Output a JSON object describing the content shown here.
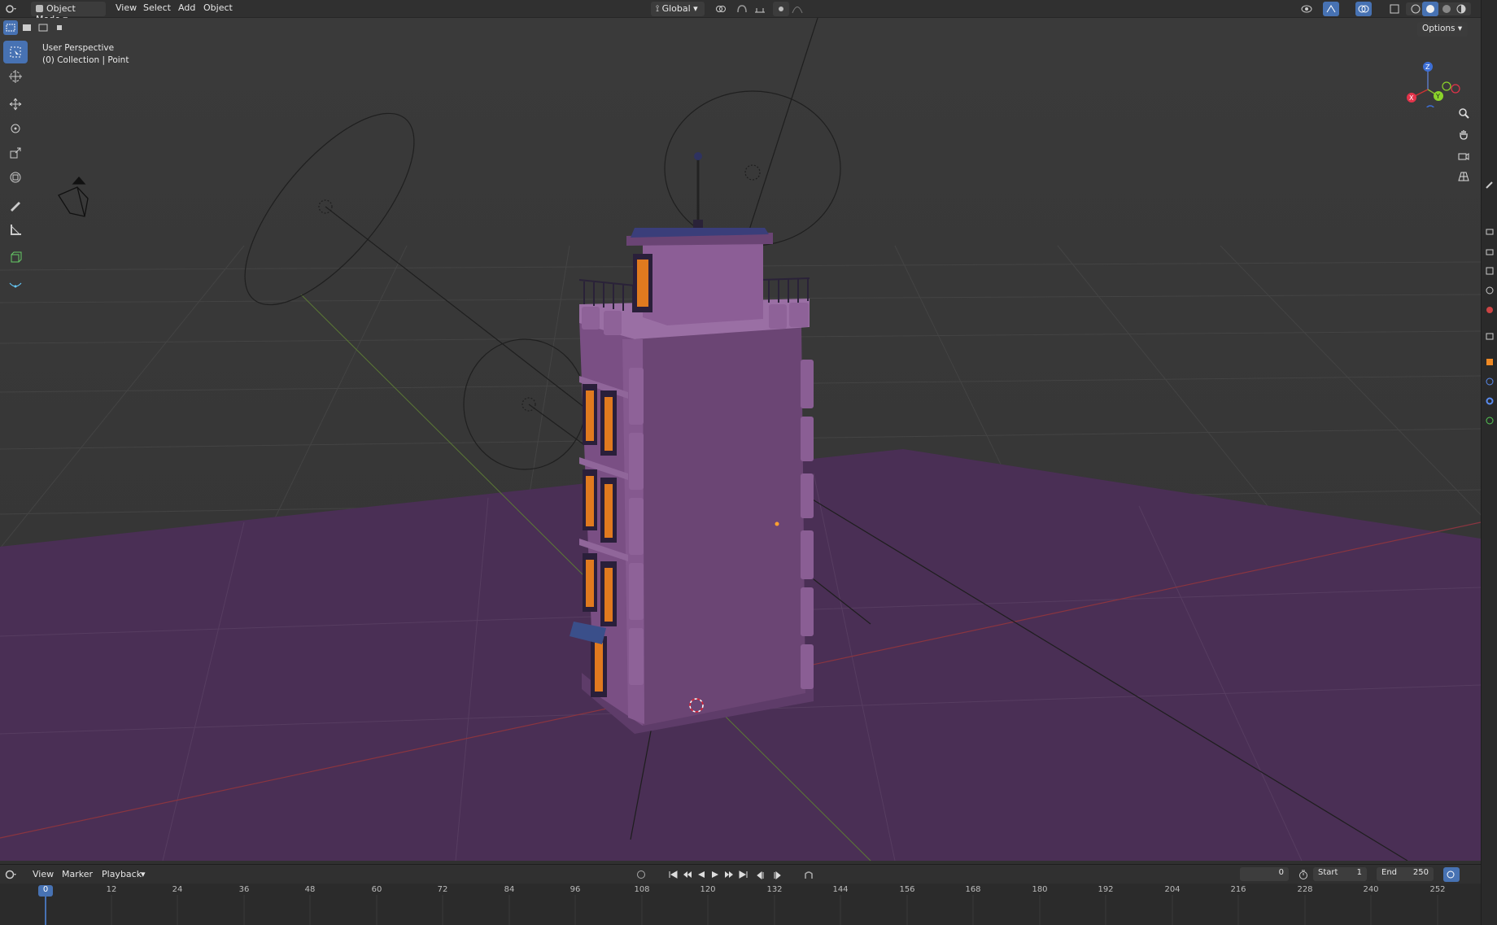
{
  "header": {
    "mode": "Object Mode",
    "menus": [
      "View",
      "Select",
      "Add",
      "Object"
    ],
    "orientation": "Global",
    "options_label": "Options"
  },
  "viewport": {
    "perspective_label": "User Perspective",
    "collection_label": "(0) Collection | Point",
    "gizmo_axes": [
      "X",
      "Y",
      "Z"
    ]
  },
  "toolbar": {
    "tools": [
      "select-box",
      "cursor",
      "move",
      "rotate",
      "scale",
      "transform",
      "annotate",
      "measure",
      "add-cube",
      "shear"
    ]
  },
  "timeline": {
    "menus": [
      "View",
      "Marker",
      "Playback"
    ],
    "current_frame": "0",
    "start_label": "Start",
    "start_value": "1",
    "end_label": "End",
    "end_value": "250",
    "ticks": [
      "0",
      "12",
      "24",
      "36",
      "48",
      "60",
      "72",
      "84",
      "96",
      "108",
      "120",
      "132",
      "144",
      "156",
      "168",
      "180",
      "192",
      "204",
      "216",
      "228",
      "240",
      "252"
    ]
  },
  "colors": {
    "accent": "#4772b3",
    "ground": "#4a2f55",
    "building": "#7d4f86",
    "window": "#e07a1f"
  }
}
